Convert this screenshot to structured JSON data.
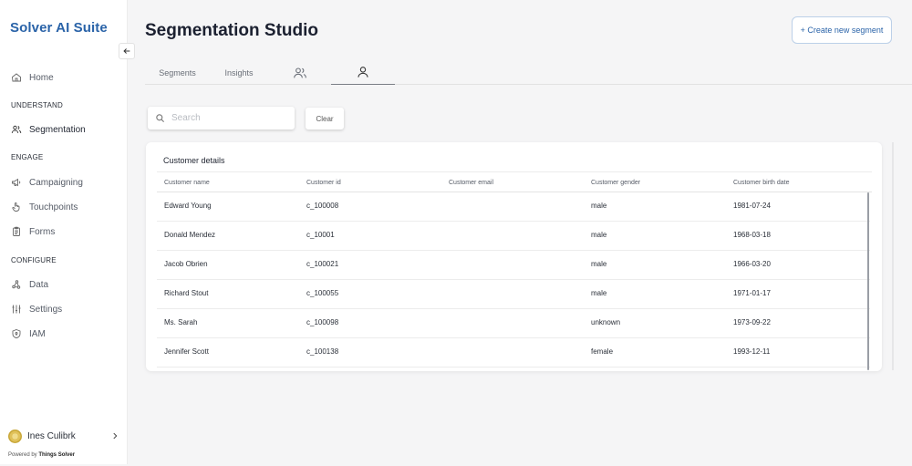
{
  "app": {
    "brand": "Solver AI Suite"
  },
  "sidebar": {
    "home": "Home",
    "sections": {
      "understand": "UNDERSTAND",
      "engage": "ENGAGE",
      "configure": "CONFIGURE"
    },
    "items": {
      "segmentation": "Segmentation",
      "campaigning": "Campaigning",
      "touchpoints": "Touchpoints",
      "forms": "Forms",
      "data": "Data",
      "settings": "Settings",
      "iam": "IAM"
    },
    "user": {
      "name": "Ines Culibrk"
    },
    "powered_by": {
      "prefix": "Powered by ",
      "company": "Things Solver"
    }
  },
  "header": {
    "title": "Segmentation Studio",
    "create_button": "+ Create new segment"
  },
  "tabs": [
    {
      "label": "Segments"
    },
    {
      "label": "Insights"
    },
    {
      "icon": "users-icon"
    },
    {
      "icon": "user-icon",
      "active": true
    }
  ],
  "search": {
    "placeholder": "Search",
    "value": "",
    "clear_label": "Clear"
  },
  "table": {
    "title": "Customer details",
    "columns": [
      "Customer name",
      "Customer id",
      "Customer email",
      "Customer gender",
      "Customer birth date"
    ],
    "rows": [
      [
        "Edward Young",
        "c_100008",
        "",
        "male",
        "1981-07-24"
      ],
      [
        "Donald Mendez",
        "c_10001",
        "",
        "male",
        "1968-03-18"
      ],
      [
        "Jacob Obrien",
        "c_100021",
        "",
        "male",
        "1966-03-20"
      ],
      [
        "Richard Stout",
        "c_100055",
        "",
        "male",
        "1971-01-17"
      ],
      [
        "Ms. Sarah",
        "c_100098",
        "",
        "unknown",
        "1973-09-22"
      ],
      [
        "Jennifer Scott",
        "c_100138",
        "",
        "female",
        "1993-12-11"
      ]
    ]
  },
  "colors": {
    "brand": "#2a63a8",
    "background": "#f5f5f6"
  }
}
